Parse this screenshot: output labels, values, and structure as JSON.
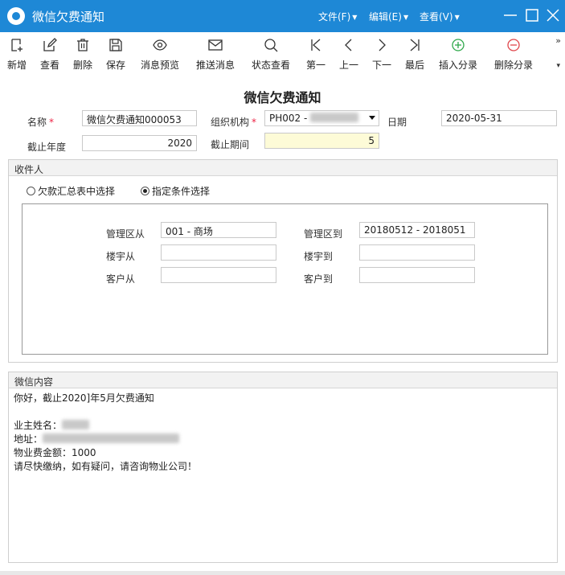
{
  "window": {
    "title": "微信欠费通知",
    "menus": [
      {
        "label": "文件(F)"
      },
      {
        "label": "编辑(E)"
      },
      {
        "label": "查看(V)"
      }
    ],
    "accent_color": "#1e88d6"
  },
  "toolbar": {
    "items": [
      {
        "label": "新增",
        "icon": "new-icon"
      },
      {
        "label": "查看",
        "icon": "edit-icon"
      },
      {
        "label": "删除",
        "icon": "trash-icon"
      },
      {
        "label": "保存",
        "icon": "save-icon"
      },
      {
        "label": "消息预览",
        "icon": "eye-icon"
      },
      {
        "label": "推送消息",
        "icon": "mail-icon"
      },
      {
        "label": "状态查看",
        "icon": "search-icon"
      },
      {
        "label": "第一",
        "icon": "first-icon"
      },
      {
        "label": "上一",
        "icon": "prev-icon"
      },
      {
        "label": "下一",
        "icon": "next-icon"
      },
      {
        "label": "最后",
        "icon": "last-icon"
      },
      {
        "label": "插入分录",
        "icon": "plus-circle-icon"
      },
      {
        "label": "删除分录",
        "icon": "minus-circle-icon"
      }
    ],
    "more": "»"
  },
  "form": {
    "title": "微信欠费通知",
    "name_label": "名称",
    "name_value": "微信欠费通知000053",
    "org_label": "组织机构",
    "org_value": "PH002 - ",
    "date_label": "日期",
    "date_value": "2020-05-31",
    "year_label": "截止年度",
    "year_value": "2020",
    "period_label": "截止期间",
    "period_value": "5"
  },
  "recipients": {
    "header": "收件人",
    "option1": "欠款汇总表中选择",
    "option2": "指定条件选择",
    "area_from_label": "管理区从",
    "area_from_value": "001 - 商场",
    "area_to_label": "管理区到",
    "area_to_value": "20180512 - 2018051",
    "building_from_label": "楼宇从",
    "building_from_value": "",
    "building_to_label": "楼宇到",
    "building_to_value": "",
    "customer_from_label": "客户从",
    "customer_from_value": "",
    "customer_to_label": "客户到",
    "customer_to_value": ""
  },
  "message": {
    "header": "微信内容",
    "line1": "你好，截止2020]年5月欠费通知",
    "line2": "",
    "line3": "业主姓名：",
    "line4": "地址：",
    "line5": "物业费金额：1000",
    "line6": "请尽快缴纳，如有疑问，请咨询物业公司！"
  }
}
